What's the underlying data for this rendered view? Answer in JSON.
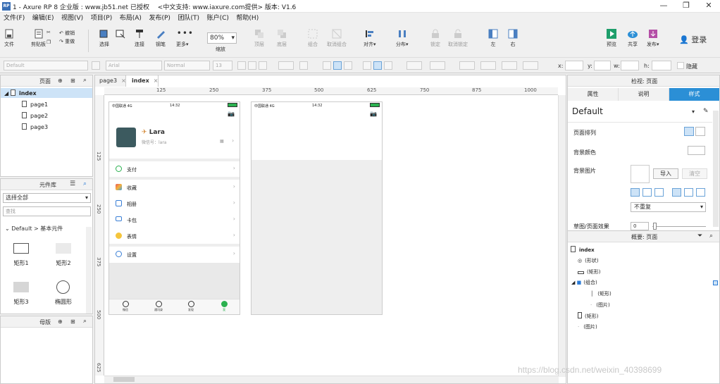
{
  "app": {
    "title": "1 - Axure RP 8 企业版 : www.jb51.net 已授权　 <中文支持: www.iaxure.com提供> 版本: V1.6",
    "logo": "RP"
  },
  "menu": [
    "文件(F)",
    "编辑(E)",
    "视图(V)",
    "项目(P)",
    "布局(A)",
    "发布(P)",
    "团队(T)",
    "账户(C)",
    "帮助(H)"
  ],
  "toolbar": {
    "file": "文件",
    "clipboard": "剪贴板",
    "cut": "剪切",
    "copy": "复制",
    "paste": "粘贴",
    "redo": "重做",
    "undo": "撤销",
    "select": "选择",
    "connect": "连接",
    "pen": "钢笔",
    "more": "更多▾",
    "zoom_value": "80%",
    "zoom_label": "缩放",
    "top": "顶层",
    "bottom": "底层",
    "group": "组合",
    "ungroup": "取消组合",
    "align": "对齐▾",
    "distribute": "分布▾",
    "lock": "锁定",
    "unlock": "取消锁定",
    "left": "左",
    "right": "右",
    "preview": "预览",
    "share": "共享",
    "publish": "发布▾",
    "login": "登录"
  },
  "format": {
    "style": "Default",
    "font": "Arial",
    "weight": "Normal",
    "size": "13",
    "x_label": "x:",
    "y_label": "y:",
    "w_label": "w:",
    "h_label": "h:",
    "hidden": "隐藏"
  },
  "pages_panel": {
    "title": "页面",
    "root": "index",
    "pages": [
      "page1",
      "page2",
      "page3"
    ]
  },
  "library_panel": {
    "title": "元件库",
    "select": "选择全部",
    "search_placeholder": "查找",
    "group": "Default > 基本元件",
    "widgets": [
      "矩形1",
      "矩形2",
      "矩形3",
      "椭圆形"
    ]
  },
  "masters_panel": {
    "title": "母版"
  },
  "tabs": [
    "page3",
    "index"
  ],
  "ruler": {
    "h": [
      "125",
      "250",
      "375",
      "500",
      "625",
      "750",
      "875",
      "1000"
    ],
    "v": [
      "125",
      "250",
      "375",
      "500",
      "625"
    ]
  },
  "phone1": {
    "carrier": "中国联通 4G",
    "time": "14:32",
    "name": "Lara",
    "wechat_id": "微信号：lara",
    "menu": [
      "支付",
      "收藏",
      "相册",
      "卡包",
      "表情",
      "设置"
    ],
    "nav": [
      "微信",
      "通讯录",
      "发现",
      "我"
    ]
  },
  "phone2": {
    "carrier": "中国联通 4G",
    "time": "14:32"
  },
  "inspector": {
    "title": "检视: 页面",
    "tabs": [
      "属性",
      "说明",
      "样式"
    ],
    "style": "Default",
    "arrange": "页面排列",
    "bgcolor": "背景颜色",
    "bgimage": "背景图片",
    "import": "导入",
    "clear": "清空",
    "repeat": "不重复",
    "sketch": "草图/页面效果",
    "sketch_value": "0"
  },
  "outline": {
    "title": "概要: 页面",
    "root": "index",
    "items": [
      "(形状)",
      "(矩形)",
      "(组合)",
      "(矩形)",
      "(图片)",
      "(矩形)",
      "(图片)"
    ]
  },
  "watermark": "https://blog.csdn.net/weixin_40398699"
}
